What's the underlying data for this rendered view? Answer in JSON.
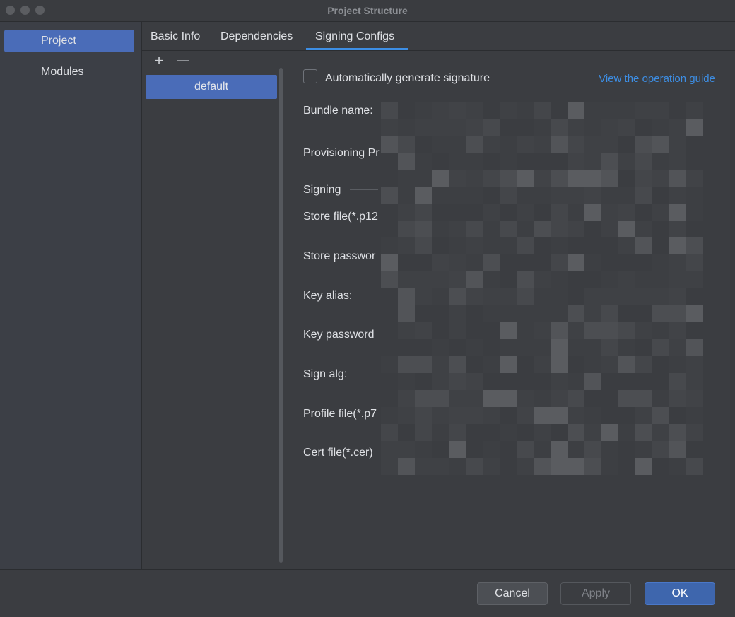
{
  "window": {
    "title": "Project Structure"
  },
  "sidebar": {
    "items": [
      {
        "label": "Project",
        "selected": true
      },
      {
        "label": "Modules",
        "selected": false
      }
    ]
  },
  "tabs": [
    {
      "label": "Basic Info"
    },
    {
      "label": "Dependencies"
    },
    {
      "label": "Signing Configs",
      "active": true
    }
  ],
  "configs": {
    "add_symbol": "+",
    "remove_symbol": "—",
    "items": [
      {
        "label": "default",
        "selected": true
      }
    ]
  },
  "form": {
    "auto_generate_label": "Automatically generate signature",
    "auto_generate_checked": false,
    "guide_link": "View the operation guide",
    "labels": {
      "bundle_name": "Bundle name:",
      "provisioning": "Provisioning Pr",
      "signing_section": "Signing",
      "store_file": "Store file(*.p12",
      "store_password": "Store passwor",
      "key_alias": "Key alias:",
      "key_password": "Key password",
      "sign_alg": "Sign alg:",
      "profile_file": "Profile file(*.p7",
      "cert_file": "Cert file(*.cer)"
    }
  },
  "footer": {
    "cancel": "Cancel",
    "apply": "Apply",
    "ok": "OK"
  },
  "colors": {
    "accent": "#3d8ee4",
    "selection": "#4a6cb8",
    "background": "#3b3d41"
  }
}
